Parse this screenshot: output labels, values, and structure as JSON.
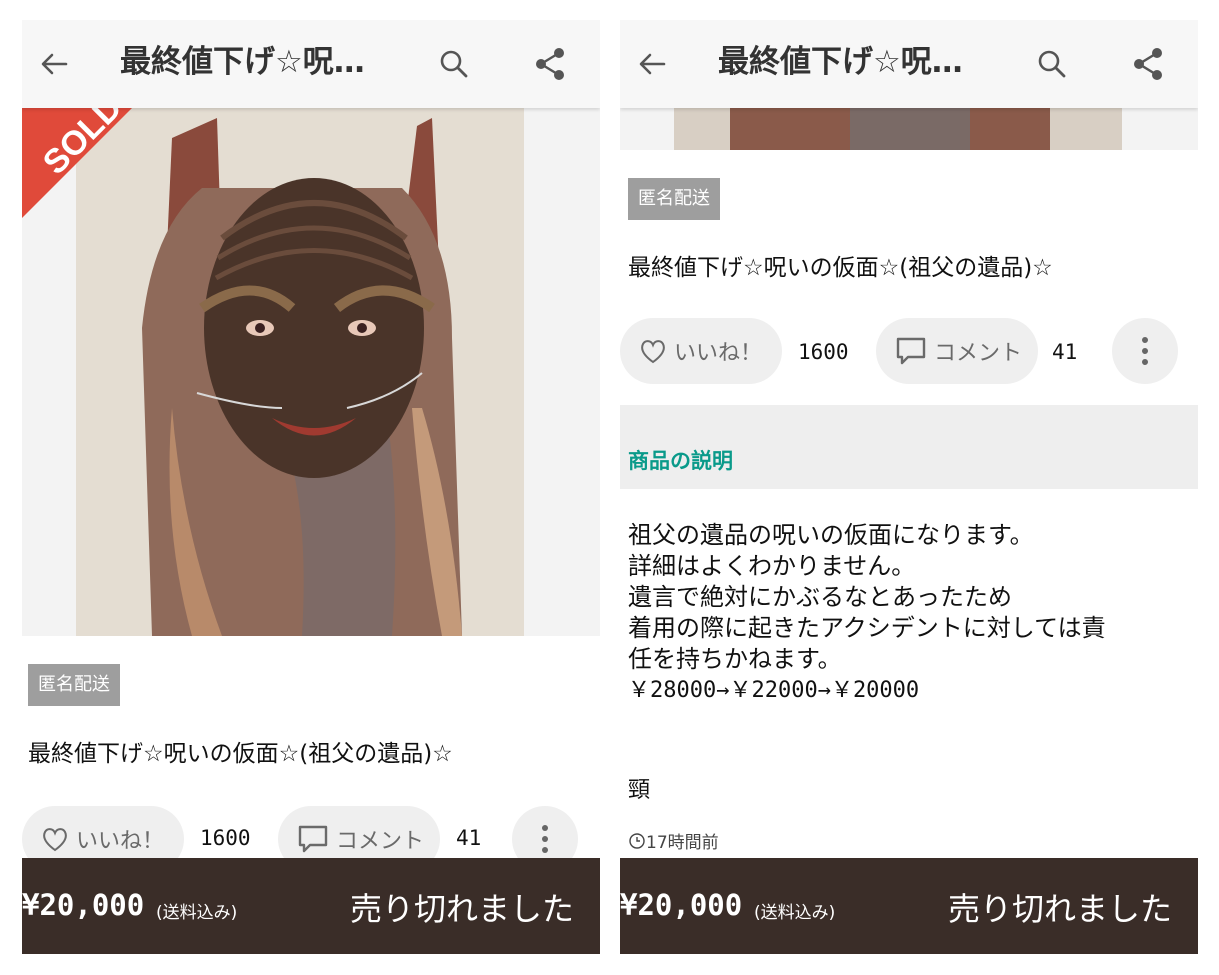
{
  "panels": [
    {
      "appbar": {
        "title": "最終値下げ☆呪…"
      },
      "sold_ribbon": "SOLD",
      "badge": "匿名配送",
      "item_title": "最終値下げ☆呪いの仮面☆(祖父の遺品)☆",
      "like": {
        "label": "いいね！",
        "count": "1600"
      },
      "comment": {
        "label": "コメント",
        "count": "41"
      },
      "bottom": {
        "price": "¥20,000",
        "shipping": "(送料込み)",
        "status": "売り切れました"
      }
    },
    {
      "appbar": {
        "title": "最終値下げ☆呪…"
      },
      "badge": "匿名配送",
      "item_title": "最終値下げ☆呪いの仮面☆(祖父の遺品)☆",
      "like": {
        "label": "いいね！",
        "count": "1600"
      },
      "comment": {
        "label": "コメント",
        "count": "41"
      },
      "description": {
        "header": "商品の説明",
        "lines": [
          "祖父の遺品の呪いの仮面になります。",
          "詳細はよくわかりません。",
          "遺言で絶対にかぶるなとあったため",
          "着用の際に起きたアクシデントに対しては責",
          "任を持ちかねます。"
        ],
        "price_history": "￥28000→￥22000→￥20000",
        "tag": "頸",
        "posted": "17時間前"
      },
      "bottom": {
        "price": "¥20,000",
        "shipping": "(送料込み)",
        "status": "売り切れました"
      }
    }
  ],
  "colors": {
    "accent": "#0a9a8a",
    "bottom_bar": "#3a2d28",
    "sold_ribbon": "#e04a3a",
    "badge": "#9e9e9e"
  },
  "icons": [
    "back-arrow-icon",
    "search-icon",
    "share-icon",
    "heart-icon",
    "comment-icon",
    "more-vertical-icon",
    "clock-icon"
  ]
}
